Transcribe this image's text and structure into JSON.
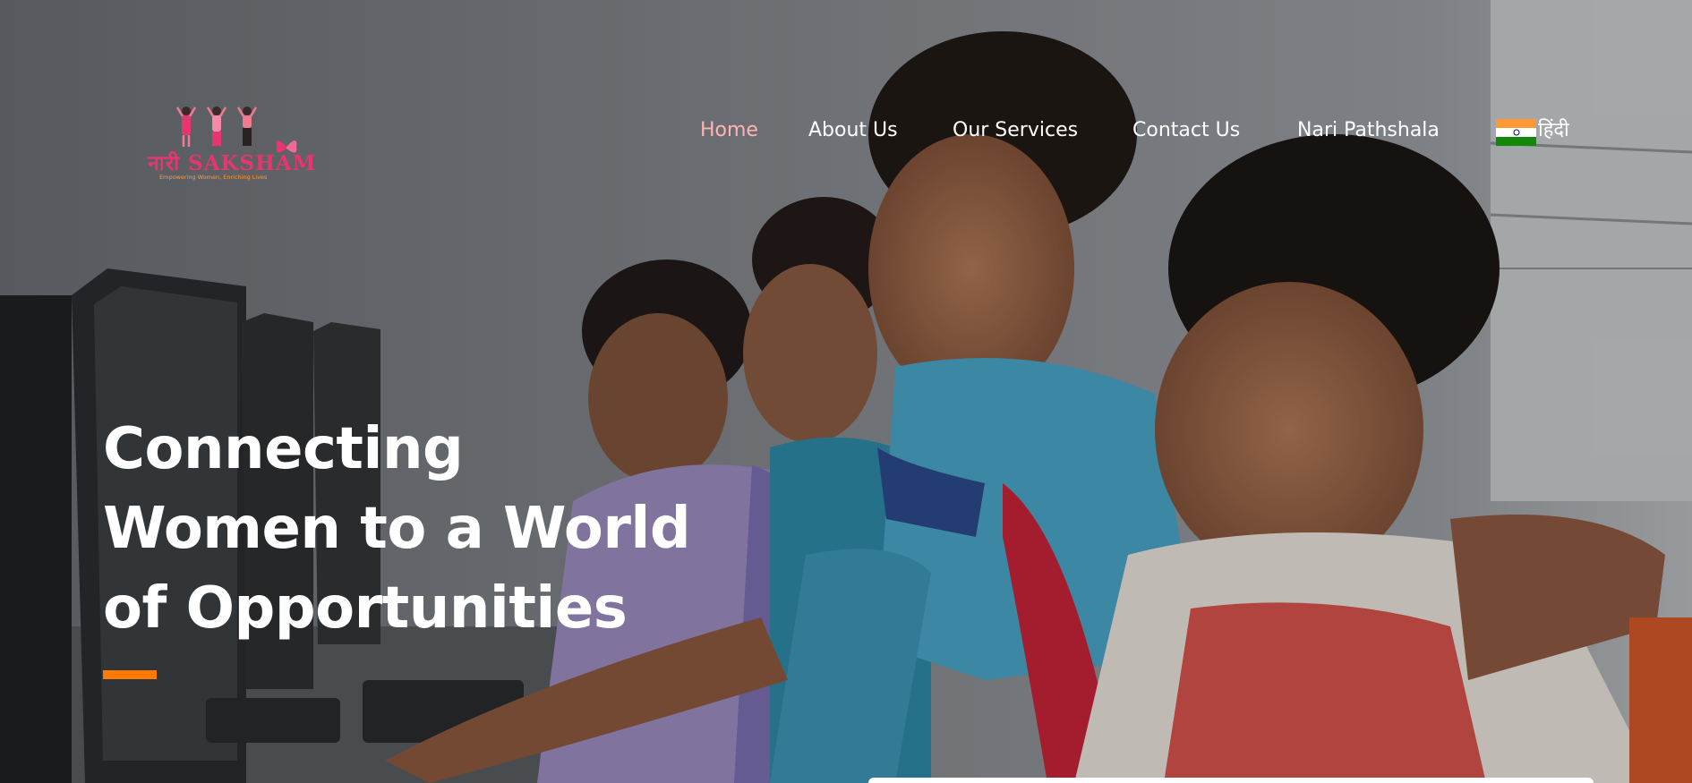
{
  "brand": {
    "logo_text": "नारी SAKSHAM",
    "tagline": "Empowering Women, Enriching Lives",
    "colors": {
      "primary": "#e6356f",
      "accent": "#ff7a00",
      "tagline": "#ff9a3c"
    }
  },
  "nav": {
    "items": [
      {
        "label": "Home",
        "active": true
      },
      {
        "label": "About Us",
        "active": false
      },
      {
        "label": "Our Services",
        "active": false
      },
      {
        "label": "Contact Us",
        "active": false
      },
      {
        "label": "Nari Pathshala",
        "active": false
      }
    ],
    "language": {
      "label": "हिंदी",
      "icon": "india-flag-icon"
    },
    "colors": {
      "active": "#ffb4b4",
      "default": "#ffffff"
    }
  },
  "hero": {
    "headline_lines": [
      "Connecting",
      "Women to a World",
      "of Opportunities"
    ],
    "background_image": "women-at-computers-photo",
    "accent_bar_color": "#ff7a00"
  }
}
